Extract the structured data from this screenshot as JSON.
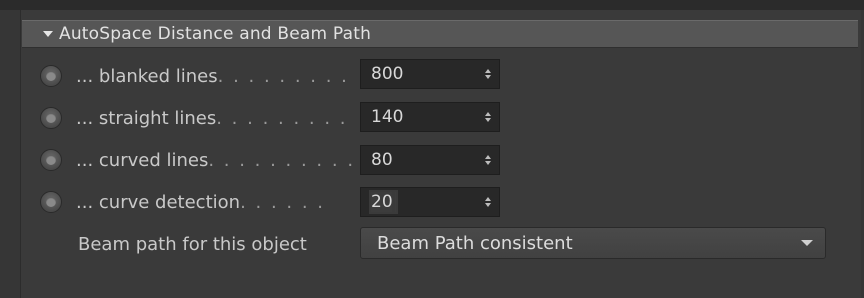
{
  "section": {
    "title": "AutoSpace Distance and Beam Path",
    "collapse_icon": "triangle-down-icon"
  },
  "rows": [
    {
      "label": "... blanked lines",
      "dots": ". . . . . . . . .",
      "value": "800"
    },
    {
      "label": "... straight lines",
      "dots": ". . . . . . . . .",
      "value": "140"
    },
    {
      "label": "... curved lines",
      "dots": ". . . . . . . . . .",
      "value": "80"
    },
    {
      "label": "... curve detection",
      "dots": ". . . . . .",
      "value": "20"
    }
  ],
  "beam_path": {
    "label": "Beam path for this object",
    "selected": "Beam Path consistent"
  },
  "colors": {
    "background": "#363636",
    "header": "#565656",
    "field": "#282828",
    "caret": "#f0a000"
  }
}
